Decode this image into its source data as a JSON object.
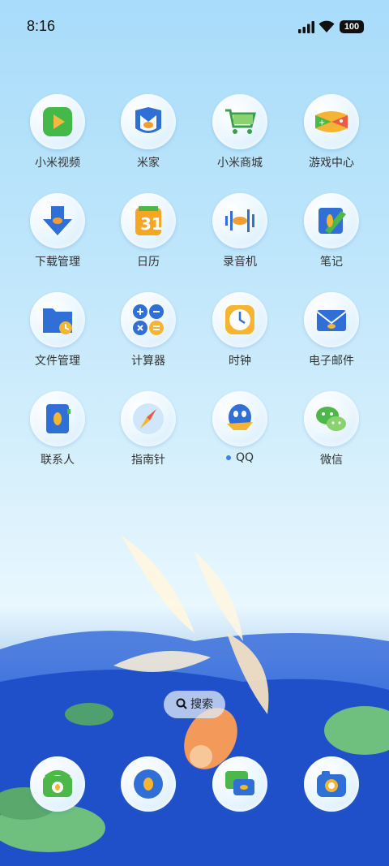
{
  "status_bar": {
    "time": "8:16",
    "battery": "100"
  },
  "apps": [
    {
      "label": "小米视频",
      "icon": "video-icon"
    },
    {
      "label": "米家",
      "icon": "mijia-icon"
    },
    {
      "label": "小米商城",
      "icon": "shopping-cart-icon"
    },
    {
      "label": "游戏中心",
      "icon": "gamepad-icon"
    },
    {
      "label": "下载管理",
      "icon": "download-icon"
    },
    {
      "label": "日历",
      "icon": "calendar-icon"
    },
    {
      "label": "录音机",
      "icon": "recorder-icon"
    },
    {
      "label": "笔记",
      "icon": "notes-icon"
    },
    {
      "label": "文件管理",
      "icon": "folder-icon"
    },
    {
      "label": "计算器",
      "icon": "calculator-icon"
    },
    {
      "label": "时钟",
      "icon": "clock-icon"
    },
    {
      "label": "电子邮件",
      "icon": "mail-icon"
    },
    {
      "label": "联系人",
      "icon": "contacts-icon"
    },
    {
      "label": "指南针",
      "icon": "compass-icon"
    },
    {
      "label": "QQ",
      "icon": "qq-icon"
    },
    {
      "label": "微信",
      "icon": "wechat-icon"
    }
  ],
  "calendar_day": "31",
  "search": {
    "label": "搜索"
  },
  "dock": [
    {
      "icon": "phone-icon"
    },
    {
      "icon": "browser-icon"
    },
    {
      "icon": "messages-icon"
    },
    {
      "icon": "camera-icon"
    }
  ]
}
